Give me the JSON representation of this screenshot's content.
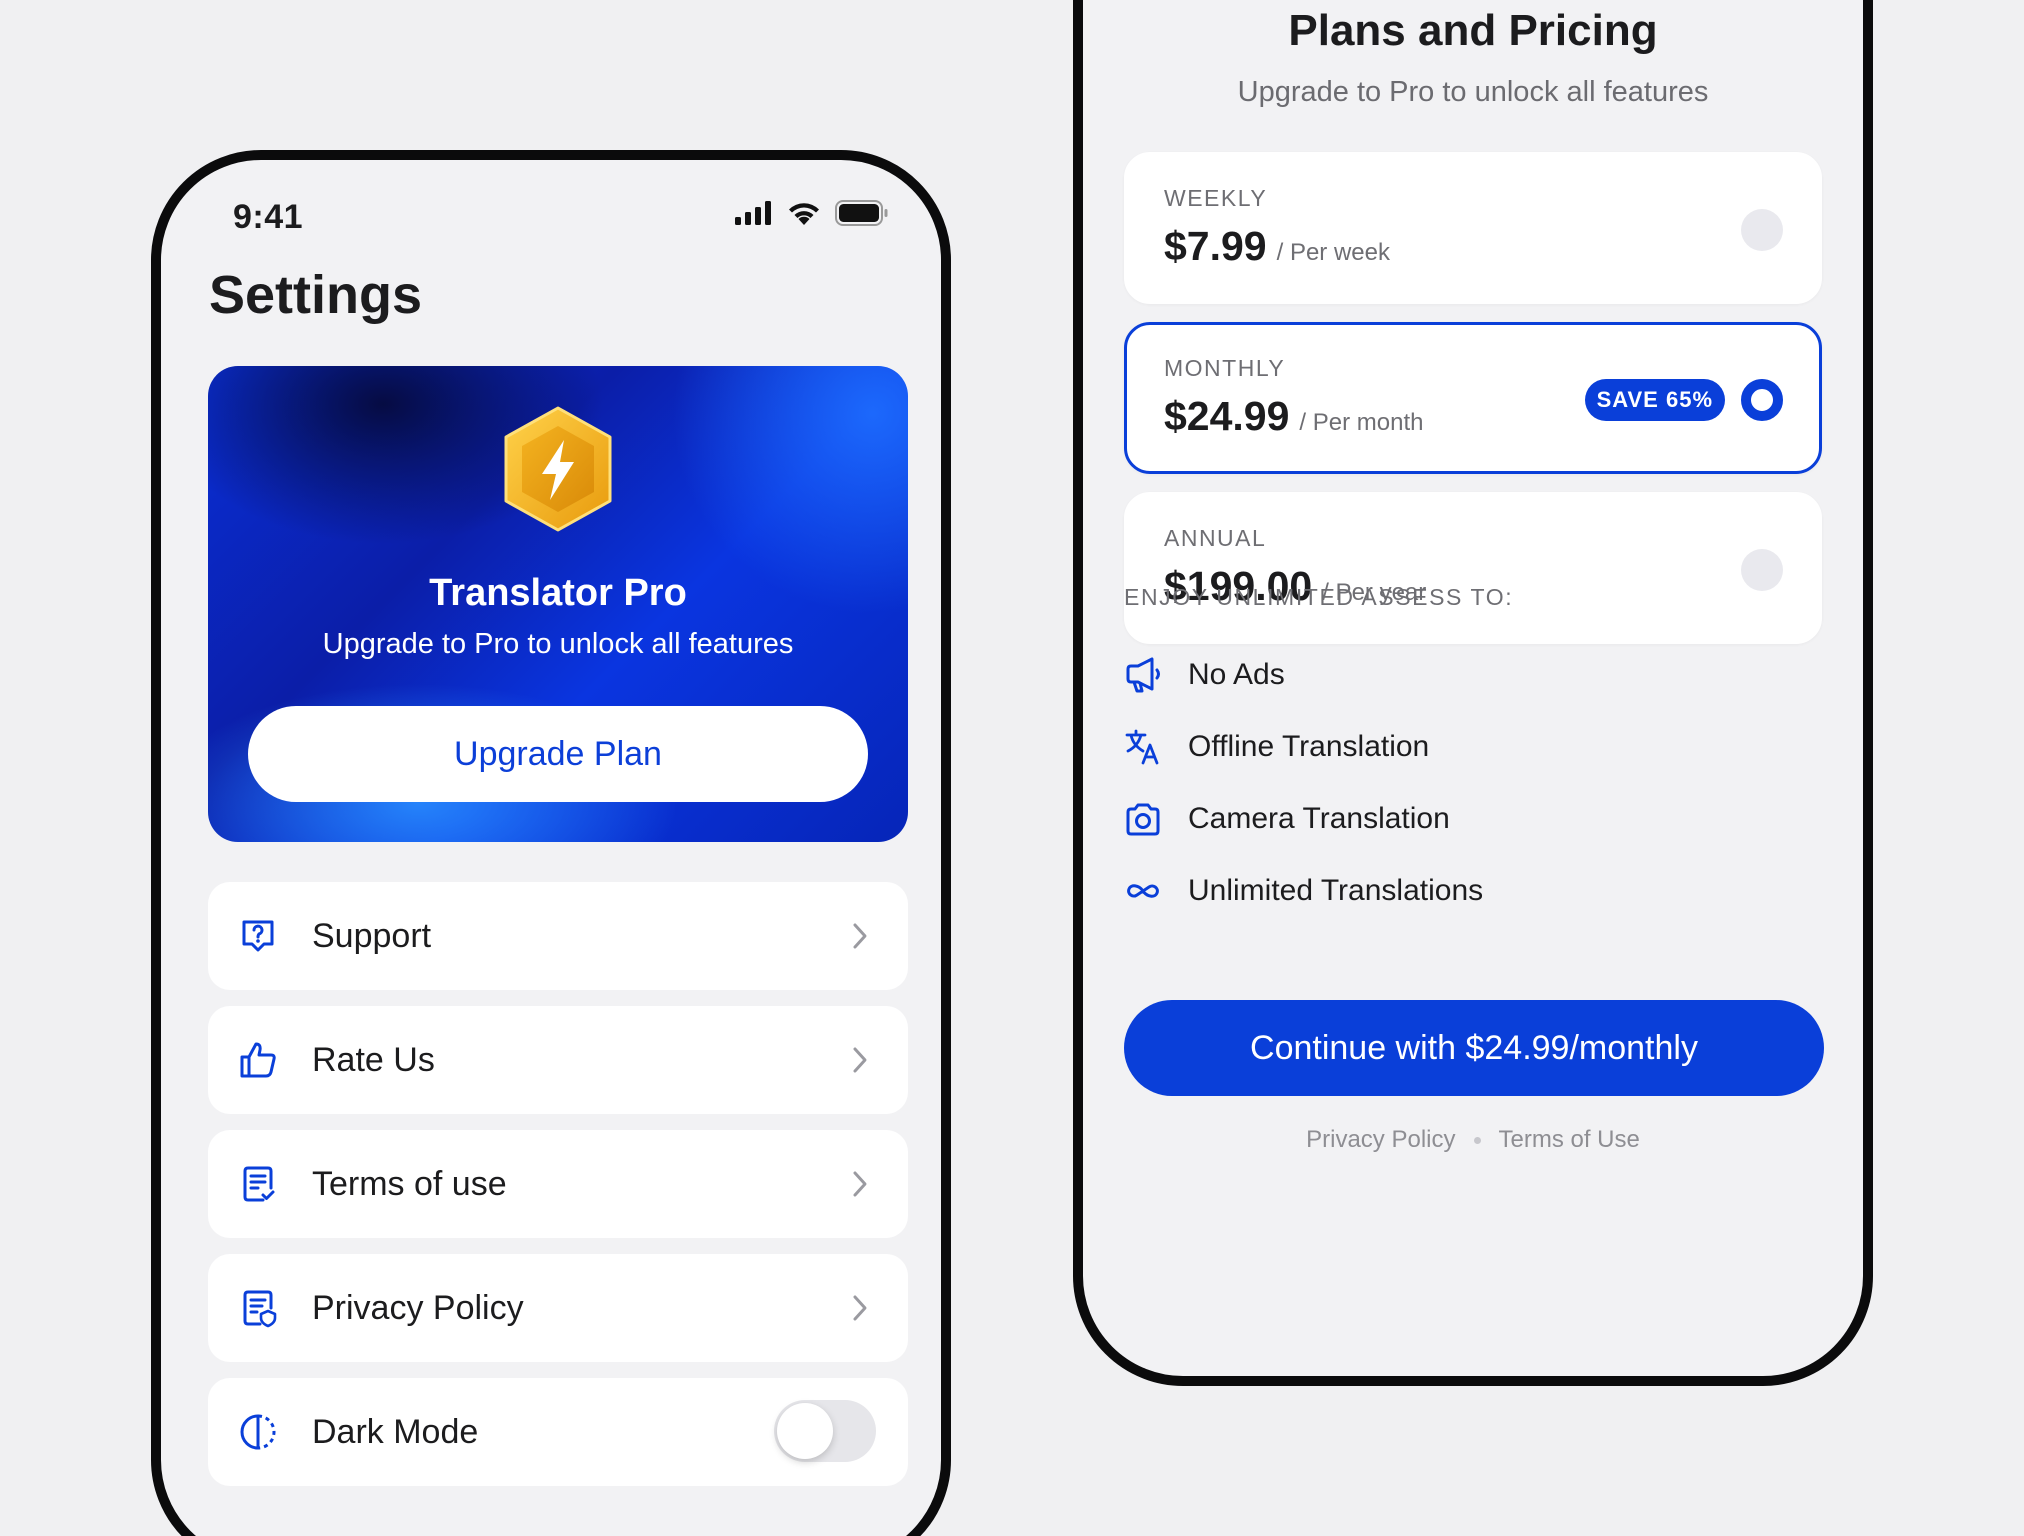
{
  "colors": {
    "accent": "#0a3fd9",
    "background": "#f0f0f2",
    "card": "#ffffff",
    "text_primary": "#1c1c1e",
    "text_secondary": "#6e6e73",
    "badge_gold": "#f2b01e"
  },
  "settings_screen": {
    "status_time": "9:41",
    "status_icons": [
      "cellular-signal-icon",
      "wifi-icon",
      "battery-icon"
    ],
    "title": "Settings",
    "promo": {
      "icon": "lightning-hexagon-badge-icon",
      "title": "Translator Pro",
      "subtitle": "Upgrade to Pro to unlock all features",
      "button_label": "Upgrade Plan"
    },
    "menu": [
      {
        "label": "Support",
        "icon": "help-chat-icon"
      },
      {
        "label": "Rate Us",
        "icon": "thumbs-up-icon"
      },
      {
        "label": "Terms of use",
        "icon": "document-check-icon"
      },
      {
        "label": "Privacy Policy",
        "icon": "document-shield-icon"
      },
      {
        "label": "Dark Mode",
        "icon": "contrast-icon",
        "toggle_on": false
      }
    ]
  },
  "pricing_screen": {
    "title": "Plans and Pricing",
    "subtitle": "Upgrade to Pro to unlock all features",
    "plans": [
      {
        "period": "WEEKLY",
        "price": "$7.99",
        "per": "/ Per week",
        "selected": false
      },
      {
        "period": "MONTHLY",
        "price": "$24.99",
        "per": "/ Per month",
        "selected": true,
        "badge": "SAVE 65%"
      },
      {
        "period": "ANNUAL",
        "price": "$199.00",
        "per": "/ Per year",
        "selected": false
      }
    ],
    "features_heading": "ENJOY UNLIMITED ASSESS TO:",
    "features": [
      {
        "label": "No Ads",
        "icon": "megaphone-icon"
      },
      {
        "label": "Offline Translation",
        "icon": "translate-icon"
      },
      {
        "label": "Camera Translation",
        "icon": "camera-icon"
      },
      {
        "label": "Unlimited Translations",
        "icon": "infinity-icon"
      }
    ],
    "continue_label": "Continue with $24.99/monthly",
    "footer_links": [
      "Privacy Policy",
      "Terms of Use"
    ]
  }
}
